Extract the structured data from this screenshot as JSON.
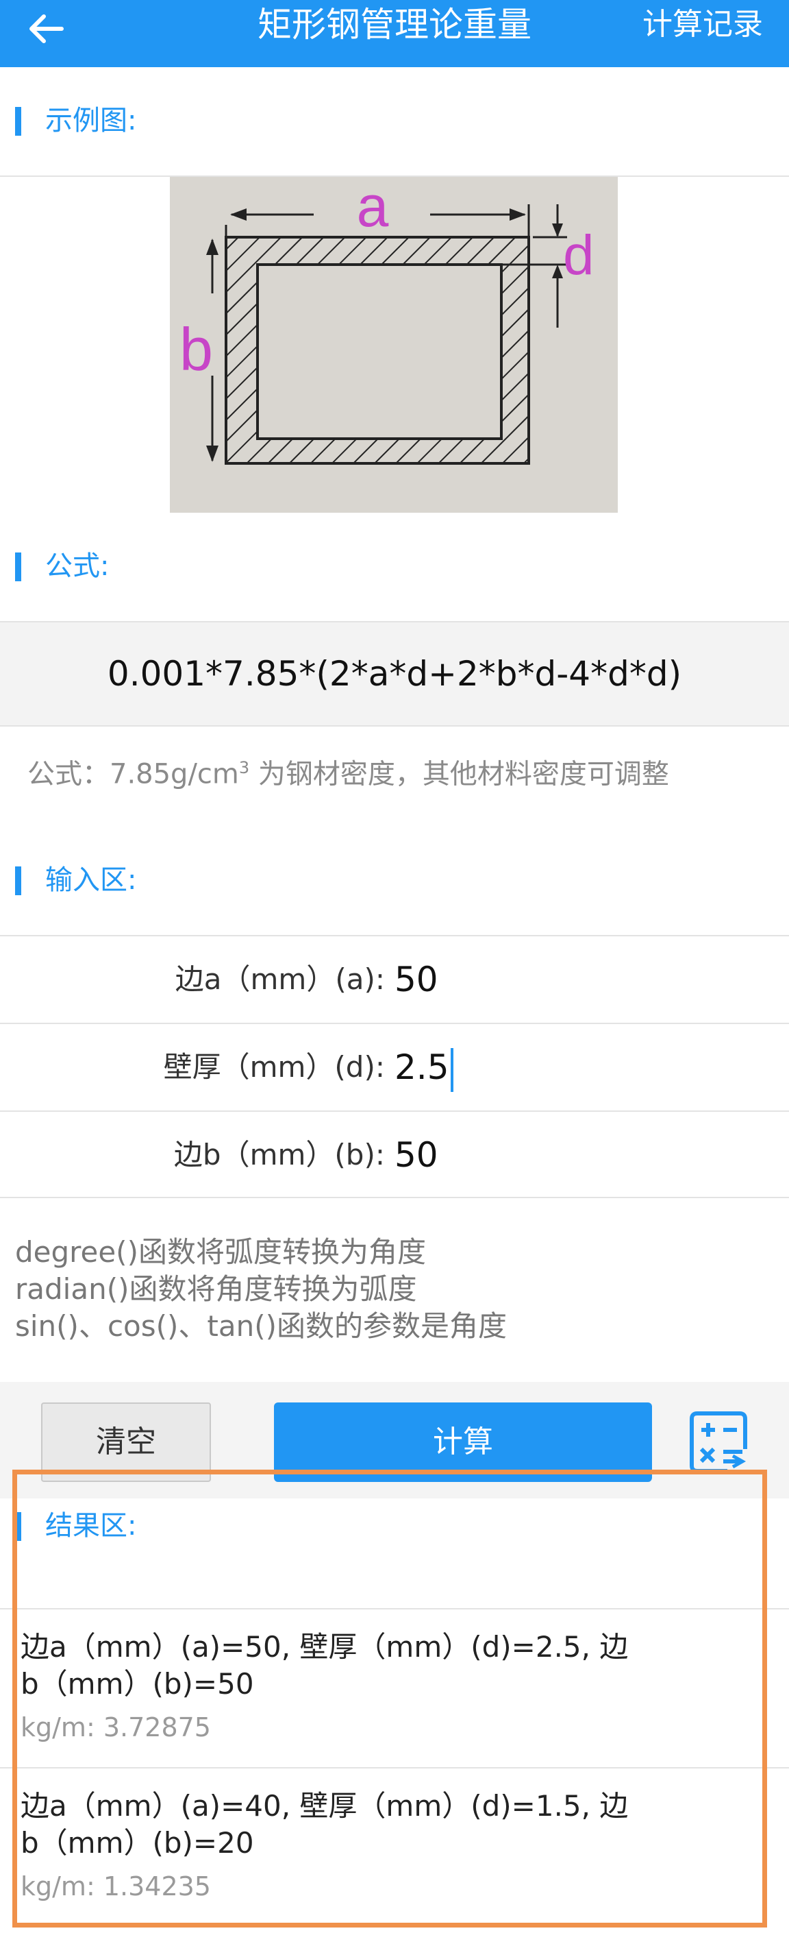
{
  "appbar": {
    "title": "矩形钢管理论重量",
    "history_label": "计算记录"
  },
  "sections": {
    "example": "示例图:",
    "formula": "公式:",
    "input": "输入区:",
    "result": "结果区:"
  },
  "diagram": {
    "label_a": "a",
    "label_b": "b",
    "label_d": "d"
  },
  "formula": {
    "expression": "0.001*7.85*(2*a*d+2*b*d-4*d*d)",
    "note_before_sup": "公式：7.85g/cm",
    "note_sup": "3",
    "note_after_sup": " 为钢材密度，其他材料密度可调整"
  },
  "inputs": [
    {
      "label": "边a（mm）(a):",
      "value": "50"
    },
    {
      "label": "壁厚（mm）(d):",
      "value": "2.5"
    },
    {
      "label": "边b（mm）(b):",
      "value": "50"
    }
  ],
  "hints": [
    "degree()函数将弧度转换为角度",
    "radian()函数将角度转换为弧度",
    "sin()、cos()、tan()函数的参数是角度"
  ],
  "buttons": {
    "clear": "清空",
    "calc": "计算"
  },
  "results": [
    {
      "line1": "边a（mm）(a)=50, 壁厚（mm）(d)=2.5, 边",
      "line2": "b（mm）(b)=50",
      "kg": "kg/m:  3.72875"
    },
    {
      "line1": "边a（mm）(a)=40, 壁厚（mm）(d)=1.5, 边",
      "line2": "b（mm）(b)=20",
      "kg": "kg/m:  1.34235"
    }
  ],
  "colors": {
    "primary": "#2196F3",
    "highlight_frame": "#F0914A",
    "label_magenta": "#C745C7"
  }
}
